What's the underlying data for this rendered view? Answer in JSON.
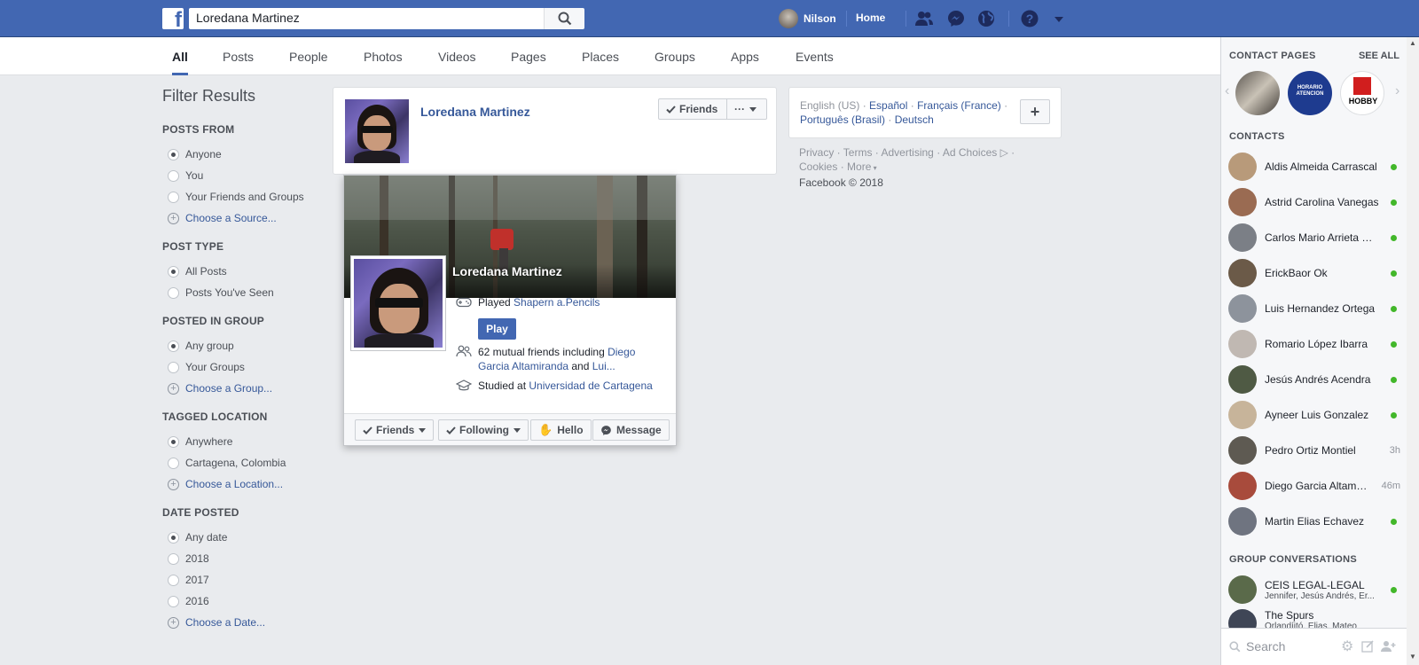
{
  "topbar": {
    "logo": "f",
    "search_value": "Loredana Martinez",
    "user_name": "Nilson",
    "home_label": "Home"
  },
  "tabs": [
    {
      "label": "All",
      "active": true
    },
    {
      "label": "Posts"
    },
    {
      "label": "People"
    },
    {
      "label": "Photos"
    },
    {
      "label": "Videos"
    },
    {
      "label": "Pages"
    },
    {
      "label": "Places"
    },
    {
      "label": "Groups"
    },
    {
      "label": "Apps"
    },
    {
      "label": "Events"
    }
  ],
  "filters": {
    "title": "Filter Results",
    "groups": [
      {
        "heading": "POSTS FROM",
        "items": [
          {
            "label": "Anyone",
            "type": "radio",
            "selected": true
          },
          {
            "label": "You",
            "type": "radio"
          },
          {
            "label": "Your Friends and Groups",
            "type": "radio"
          },
          {
            "label": "Choose a Source...",
            "type": "link"
          }
        ]
      },
      {
        "heading": "POST TYPE",
        "items": [
          {
            "label": "All Posts",
            "type": "radio",
            "selected": true
          },
          {
            "label": "Posts You've Seen",
            "type": "radio"
          }
        ]
      },
      {
        "heading": "POSTED IN GROUP",
        "items": [
          {
            "label": "Any group",
            "type": "radio",
            "selected": true
          },
          {
            "label": "Your Groups",
            "type": "radio"
          },
          {
            "label": "Choose a Group...",
            "type": "link"
          }
        ]
      },
      {
        "heading": "TAGGED LOCATION",
        "items": [
          {
            "label": "Anywhere",
            "type": "radio",
            "selected": true
          },
          {
            "label": "Cartagena, Colombia",
            "type": "radio"
          },
          {
            "label": "Choose a Location...",
            "type": "link"
          }
        ]
      },
      {
        "heading": "DATE POSTED",
        "items": [
          {
            "label": "Any date",
            "type": "radio",
            "selected": true
          },
          {
            "label": "2018",
            "type": "radio"
          },
          {
            "label": "2017",
            "type": "radio"
          },
          {
            "label": "2016",
            "type": "radio"
          },
          {
            "label": "Choose a Date...",
            "type": "link"
          }
        ]
      }
    ]
  },
  "result": {
    "name": "Loredana Martinez",
    "friends_label": "Friends",
    "more_label": "···"
  },
  "hovercard": {
    "name": "Loredana Martinez",
    "played_prefix": "Played ",
    "played_game": "Shapern a.Pencils",
    "play_label": "Play",
    "mutual_prefix": "62 mutual friends including ",
    "mutual_link1": "Diego Garcia Altamiranda",
    "mutual_and": " and ",
    "mutual_link2": "Lui...",
    "studied_prefix": "Studied at ",
    "studied_link": "Universidad de Cartagena",
    "actions": {
      "friends": "Friends",
      "following": "Following",
      "hello": "Hello",
      "message": "Message"
    }
  },
  "languages": {
    "current": "English (US)",
    "others": [
      "Español",
      "Français (France)",
      "Português (Brasil)",
      "Deutsch"
    ],
    "add_label": "+"
  },
  "footer": {
    "links": [
      "Privacy",
      "Terms",
      "Advertising",
      "Ad Choices",
      "Cookies",
      "More"
    ],
    "copyright": "Facebook © 2018"
  },
  "chat": {
    "contact_pages_label": "CONTACT PAGES",
    "see_all_label": "SEE ALL",
    "page_thumbs": [
      "",
      "HORARIO ATENCION",
      "HOBBY"
    ],
    "contacts_label": "CONTACTS",
    "contacts": [
      {
        "name": "Aldis Almeida Carrascal",
        "status": "online",
        "color": "#b89a7a"
      },
      {
        "name": "Astrid Carolina Vanegas",
        "status": "online",
        "color": "#9a6b52"
      },
      {
        "name": "Carlos Mario Arrieta Rios",
        "status": "online",
        "color": "#7b7f86"
      },
      {
        "name": "ErickBaor Ok",
        "status": "online",
        "color": "#6b5a48"
      },
      {
        "name": "Luis Hernandez Ortega",
        "status": "online",
        "color": "#8d939c"
      },
      {
        "name": "Romario López Ibarra",
        "status": "online",
        "color": "#c0b8b2"
      },
      {
        "name": "Jesús Andrés Acendra",
        "status": "online",
        "color": "#4f5a44"
      },
      {
        "name": "Ayneer Luis Gonzalez",
        "status": "online",
        "color": "#c7b49a"
      },
      {
        "name": "Pedro Ortiz Montiel",
        "status": "3h",
        "color": "#5e5a52"
      },
      {
        "name": "Diego Garcia Altamiranda",
        "status": "46m",
        "color": "#a84b3c"
      },
      {
        "name": "Martin Elias Echavez",
        "status": "online",
        "color": "#6f7480"
      }
    ],
    "group_label": "GROUP CONVERSATIONS",
    "groups": [
      {
        "name": "CEIS LEGAL-LEGAL",
        "members": "Jennifer, Jesús Andrés, Er...",
        "status": "online",
        "color": "#5a6a4a"
      },
      {
        "name": "The Spurs",
        "members": "Órlandíitó, Elias, Mateo",
        "status": "",
        "color": "#3f4656"
      }
    ],
    "search_placeholder": "Search"
  }
}
